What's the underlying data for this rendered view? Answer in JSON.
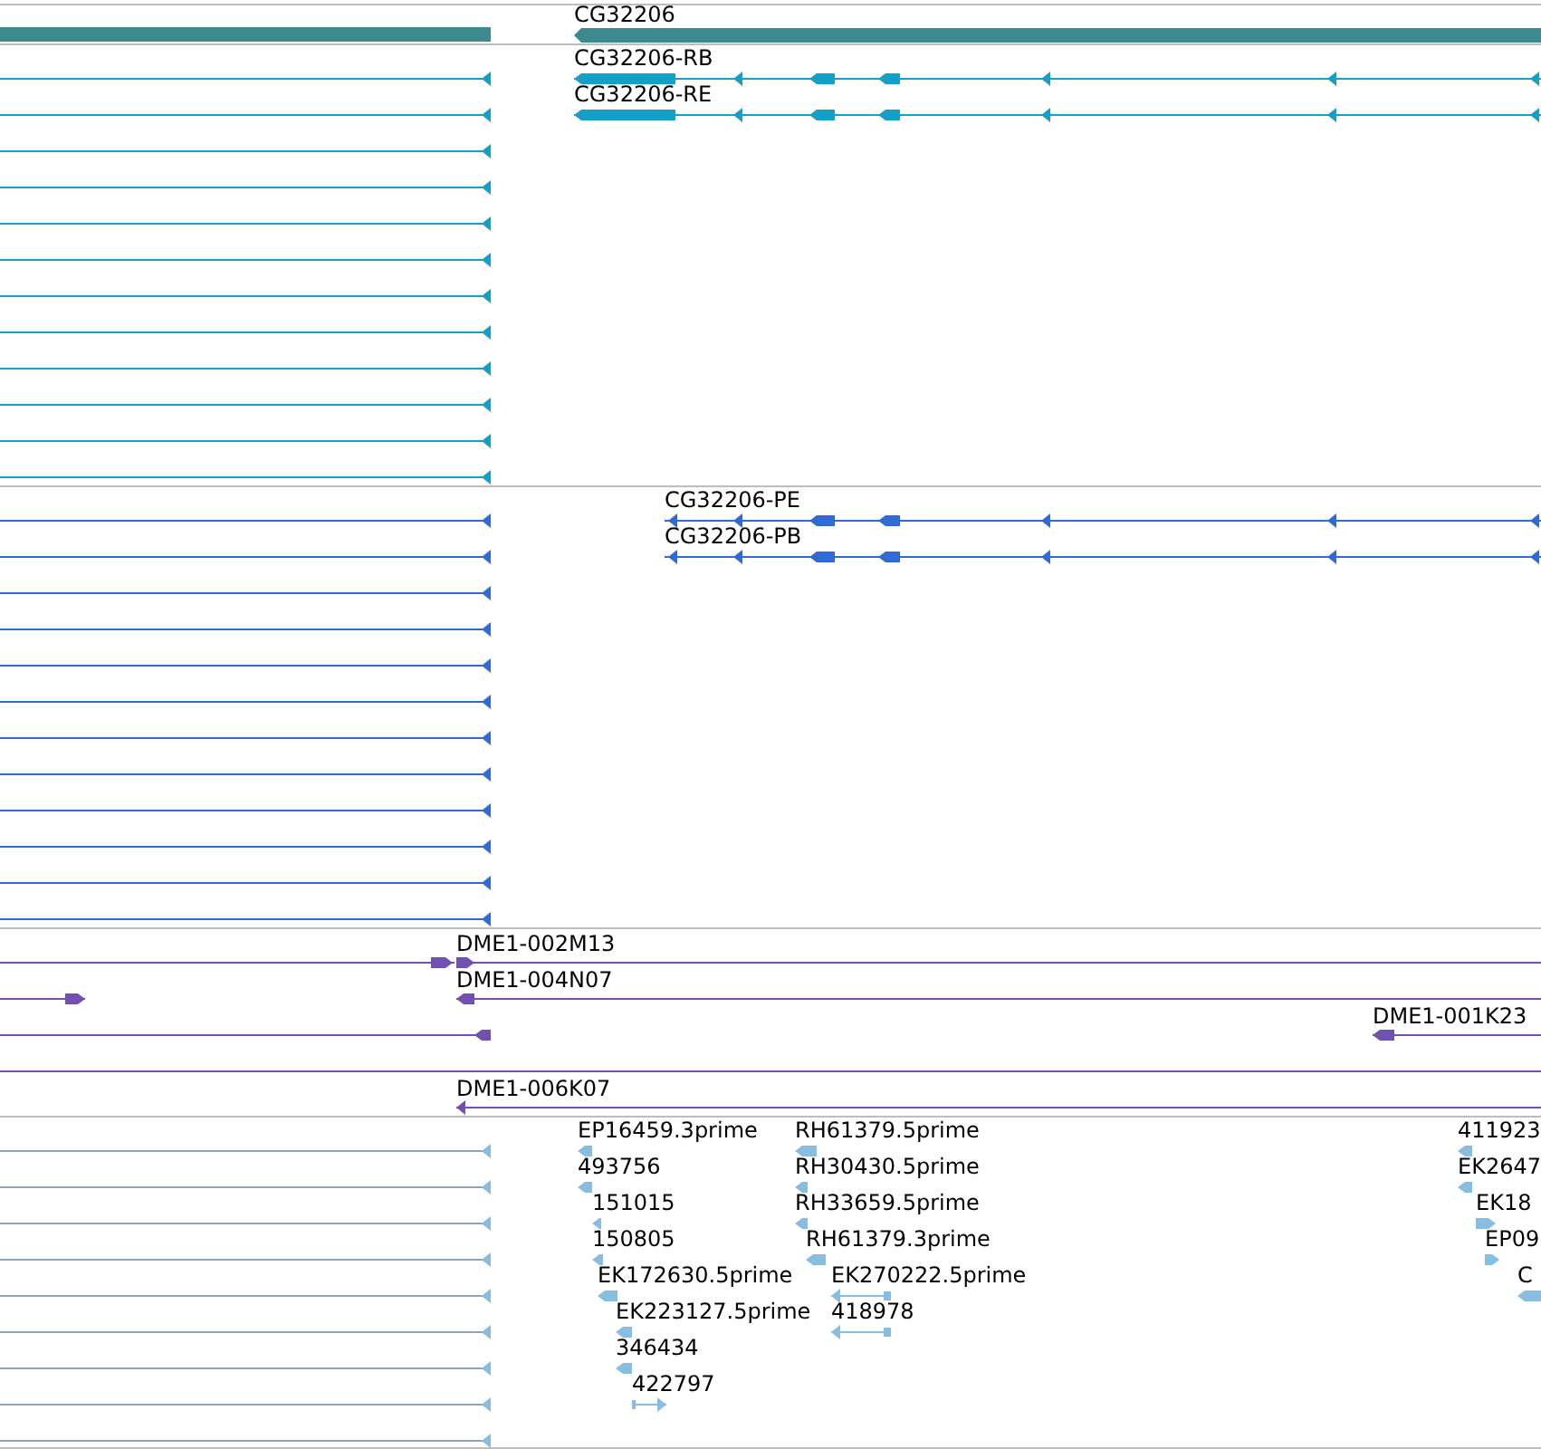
{
  "tracks": [
    {
      "kind": "gene",
      "features": [
        {
          "label": "CG32206",
          "reverse_strand": true
        }
      ]
    },
    {
      "kind": "transcript",
      "features": [
        {
          "label": "CG32206-RB",
          "reverse_strand": true
        },
        {
          "label": "CG32206-RE",
          "reverse_strand": true
        }
      ]
    },
    {
      "kind": "protein",
      "features": [
        {
          "label": "CG32206-PE",
          "reverse_strand": true
        },
        {
          "label": "CG32206-PB",
          "reverse_strand": true
        }
      ]
    },
    {
      "kind": "clone",
      "features": [
        {
          "label": "DME1-002M13",
          "reverse_strand": false
        },
        {
          "label": "DME1-004N07",
          "reverse_strand": true
        },
        {
          "label": "DME1-001K23",
          "reverse_strand": true
        },
        {
          "label": "DME1-006K07",
          "reverse_strand": true
        }
      ]
    },
    {
      "kind": "est",
      "features": [
        {
          "label": "EP16459.3prime",
          "reverse_strand": true
        },
        {
          "label": "493756",
          "reverse_strand": true
        },
        {
          "label": "151015",
          "reverse_strand": true
        },
        {
          "label": "150805",
          "reverse_strand": true
        },
        {
          "label": "EK172630.5prime",
          "reverse_strand": true
        },
        {
          "label": "EK223127.5prime",
          "reverse_strand": true
        },
        {
          "label": "346434",
          "reverse_strand": true
        },
        {
          "label": "422797",
          "reverse_strand": false
        },
        {
          "label": "RH61379.5prime",
          "reverse_strand": true
        },
        {
          "label": "RH30430.5prime",
          "reverse_strand": true
        },
        {
          "label": "RH33659.5prime",
          "reverse_strand": true
        },
        {
          "label": "RH61379.3prime",
          "reverse_strand": true
        },
        {
          "label": "EK270222.5prime",
          "reverse_strand": true
        },
        {
          "label": "418978",
          "reverse_strand": true
        },
        {
          "label": "411923",
          "reverse_strand": true
        },
        {
          "label": "EK2647",
          "reverse_strand": true
        },
        {
          "label": "EK18",
          "reverse_strand": false
        },
        {
          "label": "EP09",
          "reverse_strand": false
        },
        {
          "label": "C",
          "reverse_strand": true
        }
      ]
    }
  ]
}
